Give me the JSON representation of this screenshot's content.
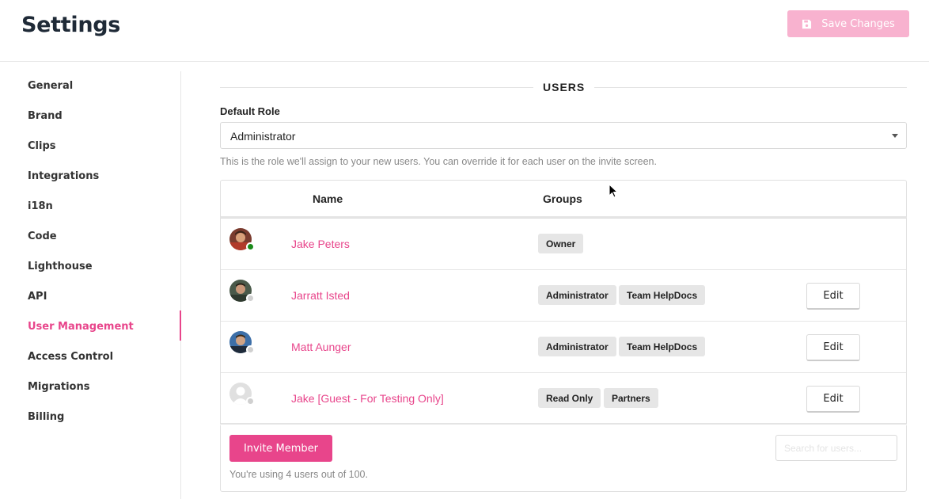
{
  "header": {
    "title": "Settings",
    "save_label": "Save Changes"
  },
  "sidebar": {
    "items": [
      {
        "label": "General"
      },
      {
        "label": "Brand"
      },
      {
        "label": "Clips"
      },
      {
        "label": "Integrations"
      },
      {
        "label": "i18n"
      },
      {
        "label": "Code"
      },
      {
        "label": "Lighthouse"
      },
      {
        "label": "API"
      },
      {
        "label": "User Management"
      },
      {
        "label": "Access Control"
      },
      {
        "label": "Migrations"
      },
      {
        "label": "Billing"
      }
    ],
    "active": "User Management"
  },
  "main": {
    "section_title": "USERS",
    "default_role": {
      "label": "Default Role",
      "value": "Administrator",
      "help": "This is the role we'll assign to your new users. You can override it for each user on the invite screen."
    },
    "table": {
      "headers": {
        "name": "Name",
        "groups": "Groups"
      },
      "rows": [
        {
          "name": "Jake Peters",
          "status": "online",
          "groups": [
            "Owner"
          ],
          "edit": ""
        },
        {
          "name": "Jarratt Isted",
          "status": "offline",
          "groups": [
            "Administrator",
            "Team HelpDocs"
          ],
          "edit": "Edit"
        },
        {
          "name": "Matt Aunger",
          "status": "offline",
          "groups": [
            "Administrator",
            "Team HelpDocs"
          ],
          "edit": "Edit"
        },
        {
          "name": "Jake [Guest - For Testing Only]",
          "status": "offline",
          "groups": [
            "Read Only",
            "Partners"
          ],
          "edit": "Edit"
        }
      ]
    },
    "footer": {
      "invite_label": "Invite Member",
      "search_placeholder": "Search for users...",
      "usage": "You're using 4 users out of 100."
    }
  },
  "colors": {
    "accent": "#e8458b",
    "save_disabled": "#f8b2cf",
    "online": "#1a8a1a",
    "offline": "#d0d0d0"
  }
}
